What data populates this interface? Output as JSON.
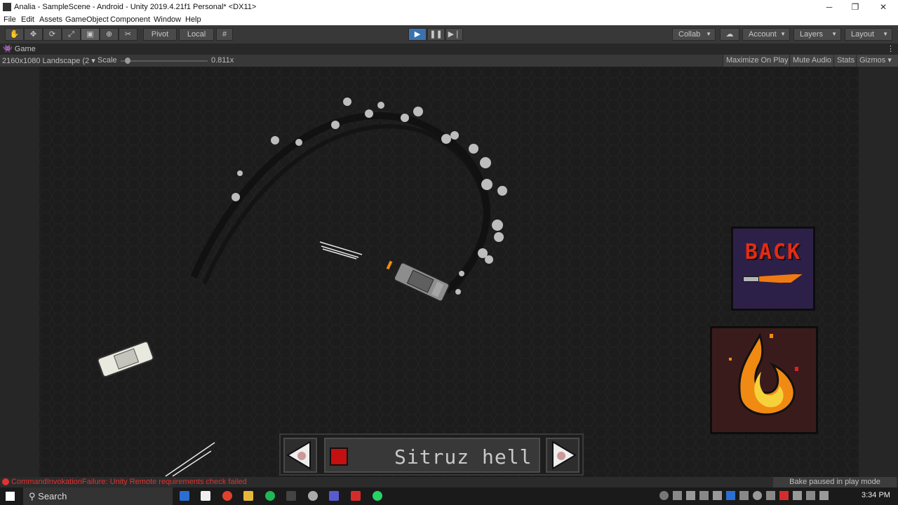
{
  "window": {
    "title": "Analia - SampleScene - Android - Unity 2019.4.21f1 Personal* <DX11>",
    "controls": [
      "─",
      "❐",
      "✕"
    ]
  },
  "menu": [
    "File",
    "Edit",
    "Assets",
    "GameObject",
    "Component",
    "Window",
    "Help"
  ],
  "toolbar": {
    "pivot_label": "Pivot",
    "local_label": "Local",
    "collab_label": "Collab",
    "account_label": "Account",
    "layers_label": "Layers",
    "layout_label": "Layout"
  },
  "game_view": {
    "tab_label": "Game",
    "resolution": "2160x1080 Landscape (2",
    "scale_label": "Scale",
    "scale_value": "0.811x",
    "scale_fraction": 0.05,
    "maximize_label": "Maximize On Play",
    "mute_label": "Mute Audio",
    "stats_label": "Stats",
    "gizmos_label": "Gizmos"
  },
  "game_ui": {
    "back_label": "BACK",
    "car_name": "Sitruz hell"
  },
  "status": {
    "error_text": "CommandInvokationFailure: Unity Remote requirements check failed",
    "bake_text": "Bake paused in play mode"
  },
  "taskbar": {
    "search_placeholder": "Search",
    "clock": "3:34 PM"
  },
  "colors": {
    "play_active": "#3a72b0",
    "error": "#d33333",
    "fire": "#f07a12",
    "back_text": "#e52b12"
  }
}
